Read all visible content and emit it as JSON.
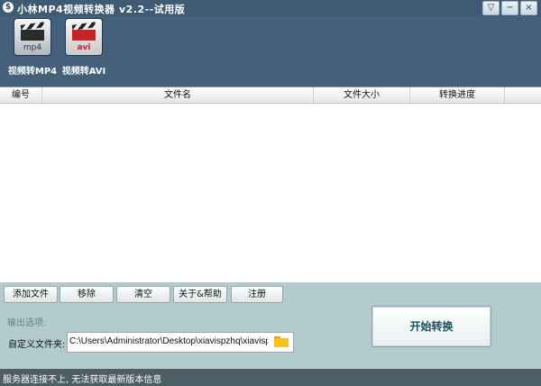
{
  "window": {
    "title": "小林MP4视频转换器 v2.2--试用版",
    "logo_glyph": "$",
    "controls": {
      "menu": "▽",
      "minimize": "−",
      "close": "×"
    }
  },
  "toolbar": {
    "tools": [
      {
        "label": "视频转MP4",
        "format": "mp4",
        "icon": "clapperboard-mp4-icon"
      },
      {
        "label": "视频转AVI",
        "format": "avi",
        "icon": "clapperboard-avi-icon"
      }
    ]
  },
  "file_table": {
    "columns": [
      "编号",
      "文件名",
      "文件大小",
      "转换进度"
    ],
    "rows": []
  },
  "actions": {
    "add": "添加文件",
    "remove": "移除",
    "clear": "清空",
    "about": "关于&帮助",
    "register": "注册"
  },
  "output": {
    "section_label": "输出选项:",
    "dir_label": "自定义文件夹:",
    "dir_value": "C:\\Users\\Administrator\\Desktop\\xiavispzhq\\xiavispzhq\\",
    "folder_icon": "folder-icon"
  },
  "start": {
    "label": "开始转换"
  },
  "status": {
    "text": "服务器连接不上, 无法获取最新版本信息"
  },
  "colors": {
    "window_bg": "#44607a",
    "panel_bg": "#b2cbcc",
    "status_bg": "#4c5e66",
    "start_text": "#184f5a"
  }
}
